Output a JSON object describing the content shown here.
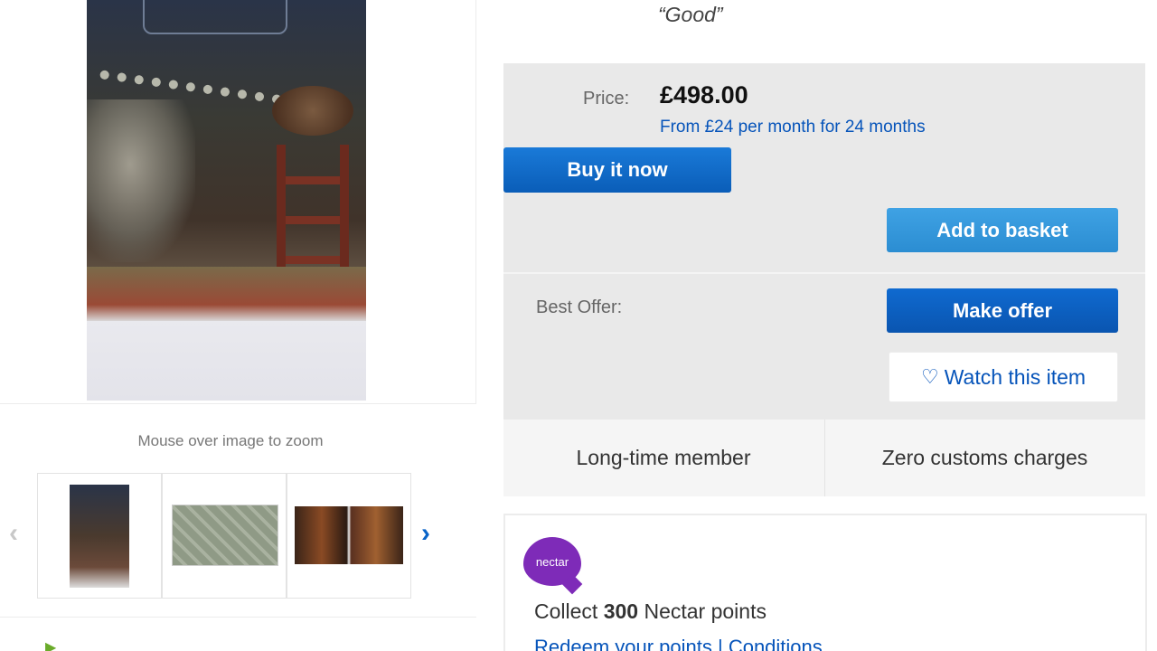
{
  "condition": {
    "quote": "“Good”"
  },
  "gallery": {
    "zoom_hint": "Mouse over image to zoom",
    "thumbnails": [
      {
        "name": "thumbnail-1"
      },
      {
        "name": "thumbnail-2"
      },
      {
        "name": "thumbnail-3"
      }
    ],
    "prev_icon": "chevron-left-icon",
    "next_icon": "chevron-right-icon"
  },
  "price_panel": {
    "price_label": "Price:",
    "price_value": "£498.00",
    "finance_text": "From £24 per month for 24 months",
    "buy_now_label": "Buy it now",
    "add_to_basket_label": "Add to basket",
    "best_offer_label": "Best Offer:",
    "make_offer_label": "Make offer",
    "watch_label": "Watch this item",
    "watch_icon": "heart-icon"
  },
  "badges": [
    "Long-time member",
    "Zero customs charges"
  ],
  "nectar": {
    "logo_text": "nectar",
    "collect_prefix": "Collect",
    "points": "300",
    "collect_suffix": "Nectar points",
    "links_text": "Redeem your points | Conditions"
  },
  "colors": {
    "link_blue": "#0654ba",
    "buy_now_blue": "#0a5db8",
    "basket_blue": "#2b8dd2",
    "nectar_purple": "#7e2bb8",
    "panel_grey": "#e9e9e9"
  }
}
